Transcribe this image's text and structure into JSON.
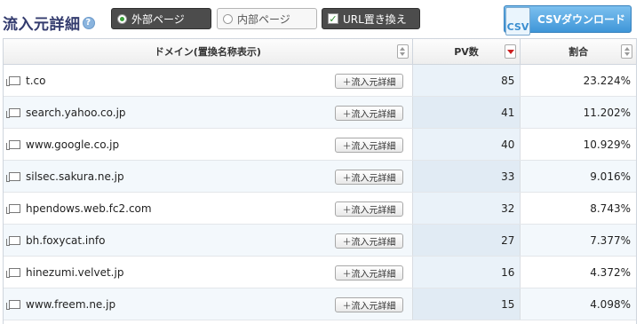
{
  "toolbar": {
    "title": "流入元詳細",
    "help_glyph": "?",
    "external_label": "外部ページ",
    "internal_label": "内部ページ",
    "replace_label": "URL置き換え",
    "replace_check": "✓",
    "csv_icon_text": "CSV",
    "csv_label": "CSVダウンロード",
    "external_selected": true,
    "replace_checked": true
  },
  "table": {
    "headers": {
      "domain": "ドメイン(置換名称表示)",
      "pv": "PV数",
      "ratio": "割合"
    },
    "detail_button_label": "＋流入元詳細",
    "rows": [
      {
        "domain": "t.co",
        "pv": "85",
        "ratio": "23.224%"
      },
      {
        "domain": "search.yahoo.co.jp",
        "pv": "41",
        "ratio": "11.202%"
      },
      {
        "domain": "www.google.co.jp",
        "pv": "40",
        "ratio": "10.929%"
      },
      {
        "domain": "silsec.sakura.ne.jp",
        "pv": "33",
        "ratio": "9.016%"
      },
      {
        "domain": "hpendows.web.fc2.com",
        "pv": "32",
        "ratio": "8.743%"
      },
      {
        "domain": "bh.foxycat.info",
        "pv": "27",
        "ratio": "7.377%"
      },
      {
        "domain": "hinezumi.velvet.jp",
        "pv": "16",
        "ratio": "4.372%"
      },
      {
        "domain": "www.freem.ne.jp",
        "pv": "15",
        "ratio": "4.098%"
      }
    ]
  },
  "colors": {
    "title": "#333b6e",
    "csv_button": "#3f96d8",
    "sort_active": "#cc1f1f",
    "row_alt": "#f3f8fc"
  },
  "icons": {
    "help": "question-circle-icon",
    "radio": "radio-icon",
    "checkbox": "checkbox-icon",
    "csv": "csv-file-icon",
    "sort": "sort-arrows-icon",
    "row": "page-icon"
  }
}
